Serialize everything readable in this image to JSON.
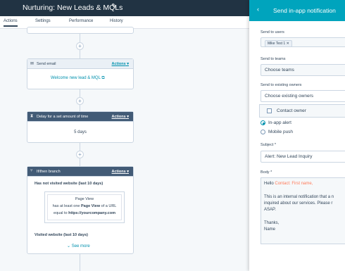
{
  "header": {
    "title": "Nurturing: New Leads & MQLs",
    "edit_icon": "pencil-icon"
  },
  "tabs": [
    "Actions",
    "Settings",
    "Performance",
    "History"
  ],
  "canvas": {
    "send_email": {
      "title": "Send email",
      "actions": "Actions",
      "email_link": "Welcome new lead & MQL"
    },
    "delay": {
      "title": "Delay for a set amount of time",
      "actions": "Actions",
      "value": "5 days"
    },
    "branch": {
      "title": "If/then branch",
      "actions": "Actions",
      "condition1": "Has not visited website (last 10 days)",
      "filter_line1": "Page View",
      "filter_line2_pre": "has at least one",
      "filter_line2_bold": "Page View",
      "filter_line2_post": "of a URL",
      "filter_line3_pre": "equal to",
      "filter_line3_bold": "https://yourcompany.com",
      "condition2": "Visited website (last 10 days)",
      "see_more": "See more"
    }
  },
  "panel": {
    "title": "Send in-app notification",
    "send_to_users_label": "Send to users",
    "user_chip": "Mike Test 1",
    "send_to_teams_label": "Send to teams",
    "teams_placeholder": "Choose teams",
    "send_to_owners_label": "Send to existing owners",
    "owners_placeholder": "Choose existing owners",
    "owner_option": "Contact owner",
    "notify_options": [
      "In-app alert",
      "Mobile push"
    ],
    "subject_label": "Subject *",
    "subject_value": "Alert: New Lead Inquiry",
    "body_label": "Body *",
    "body_greeting": "Hello",
    "body_token": "Contact: First name,",
    "body_line1": "This is an internal notification that a n",
    "body_line2": "inquired about our services. Please r",
    "body_line3": "ASAP.",
    "body_line4": "Thanks,",
    "body_line5": "Name"
  },
  "colors": {
    "header_bg": "#213343",
    "panel_header": "#00a4bd",
    "link": "#0091ae",
    "token": "#ff7a59"
  }
}
